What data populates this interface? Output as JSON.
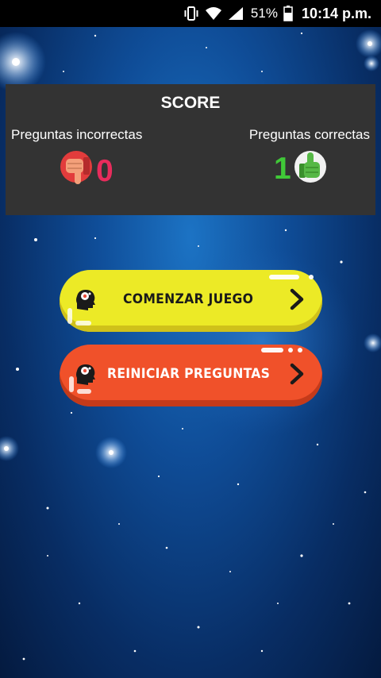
{
  "status_bar": {
    "battery": "51%",
    "time": "10:14 p.m.",
    "icons": [
      "vibrate-icon",
      "wifi-icon",
      "signal-icon",
      "battery-icon"
    ]
  },
  "score": {
    "title": "SCORE",
    "incorrect": {
      "label": "Preguntas incorrectas",
      "value": "0",
      "icon": "thumbs-down-icon",
      "color": "#e82c5c"
    },
    "correct": {
      "label": "Preguntas correctas",
      "value": "1",
      "icon": "thumbs-up-icon",
      "color": "#40c838"
    }
  },
  "buttons": {
    "start": {
      "label": "COMENZAR JUEGO",
      "color": "#ecea26",
      "icon": "brain-head-icon"
    },
    "reset": {
      "label": "REINICIAR PREGUNTAS",
      "color": "#f0512a",
      "icon": "brain-head-icon"
    }
  },
  "theme": {
    "background": "#0f4d98",
    "panel": "#333333"
  }
}
